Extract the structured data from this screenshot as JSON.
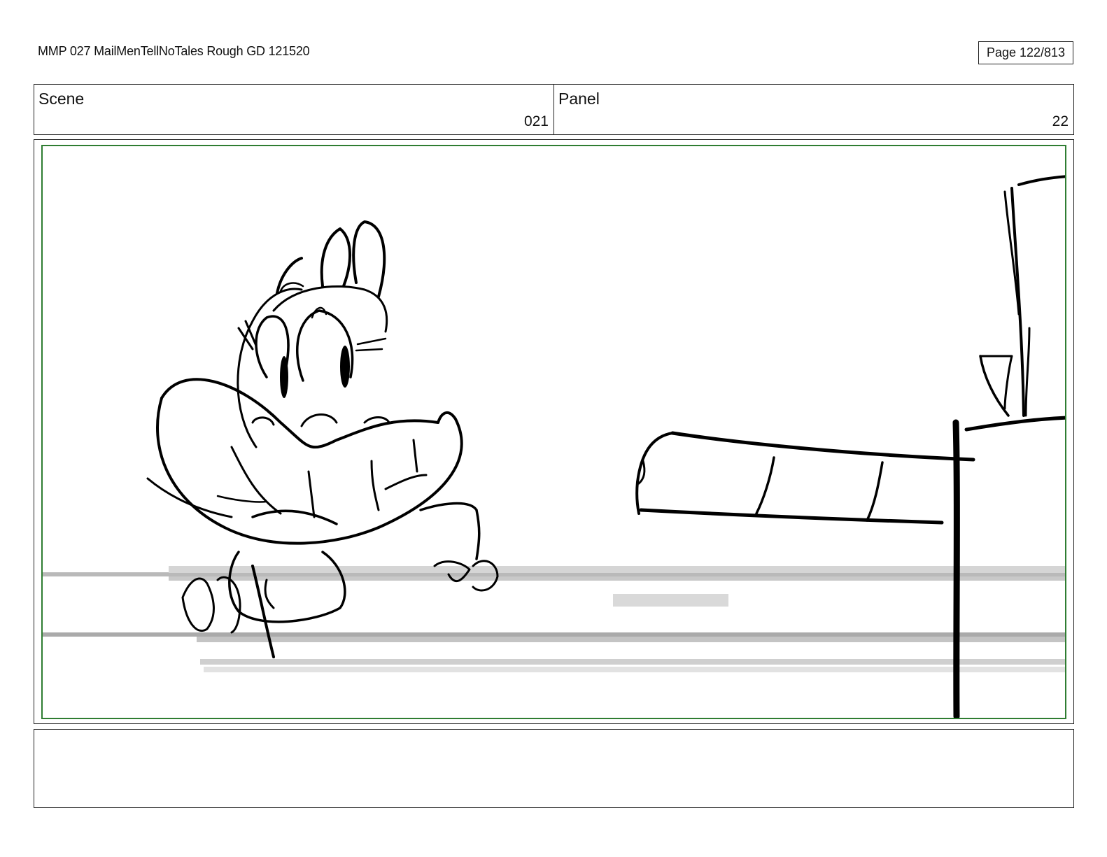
{
  "header": {
    "document_title": "MMP 027 MailMenTellNoTales Rough GD 121520",
    "page_label": "Page 122/813"
  },
  "scene": {
    "label": "Scene",
    "value": "021"
  },
  "panel": {
    "label": "Panel",
    "value": "22"
  },
  "colors": {
    "safe_frame_border": "#2f7d32",
    "sketch_line": "#000000",
    "speed_line": "#9a9a9a"
  },
  "notes": {
    "text": ""
  }
}
